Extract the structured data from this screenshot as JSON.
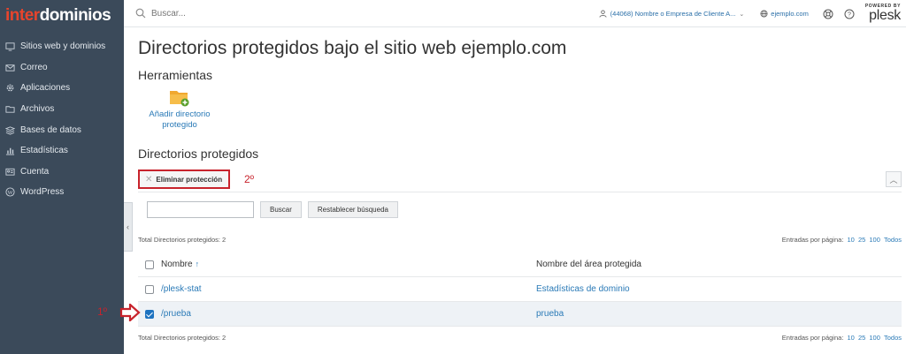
{
  "brand": {
    "logo_part1": "inter",
    "logo_part2": "dominios"
  },
  "sidebar": {
    "items": [
      {
        "label": "Sitios web y dominios",
        "icon": "monitor-icon"
      },
      {
        "label": "Correo",
        "icon": "mail-icon"
      },
      {
        "label": "Aplicaciones",
        "icon": "gear-icon"
      },
      {
        "label": "Archivos",
        "icon": "folder-icon"
      },
      {
        "label": "Bases de datos",
        "icon": "database-icon"
      },
      {
        "label": "Estadísticas",
        "icon": "chart-icon"
      },
      {
        "label": "Cuenta",
        "icon": "user-card-icon"
      },
      {
        "label": "WordPress",
        "icon": "wordpress-icon"
      }
    ]
  },
  "topbar": {
    "search_placeholder": "Buscar...",
    "account": "(44068) Nombre o Empresa de Cliente A...",
    "site": "ejemplo.com",
    "powered_by": "POWERED BY",
    "plesk": "plesk"
  },
  "main": {
    "title": "Directorios protegidos bajo el sitio web ejemplo.com",
    "tools_heading": "Herramientas",
    "tool_add_label_1": "Añadir directorio",
    "tool_add_label_2": "protegido",
    "dirs_heading": "Directorios protegidos",
    "remove_button": "Eliminar protección",
    "annotation_2": "2º",
    "annotation_1": "1º",
    "search_button": "Buscar",
    "reset_button": "Restablecer búsqueda",
    "total_text": "Total Directorios protegidos: 2",
    "per_page_label": "Entradas por página:",
    "per_page_options": [
      "10",
      "25",
      "100",
      "Todos"
    ],
    "columns": {
      "name": "Nombre",
      "area": "Nombre del área protegida"
    },
    "rows": [
      {
        "name": "/plesk-stat",
        "area": "Estadísticas de dominio",
        "checked": false
      },
      {
        "name": "/prueba",
        "area": "prueba",
        "checked": true
      }
    ]
  },
  "colors": {
    "sidebar": "#3b4a5a",
    "link": "#2a7ab7",
    "annotation": "#c8232c",
    "brand_red": "#e8442c"
  }
}
